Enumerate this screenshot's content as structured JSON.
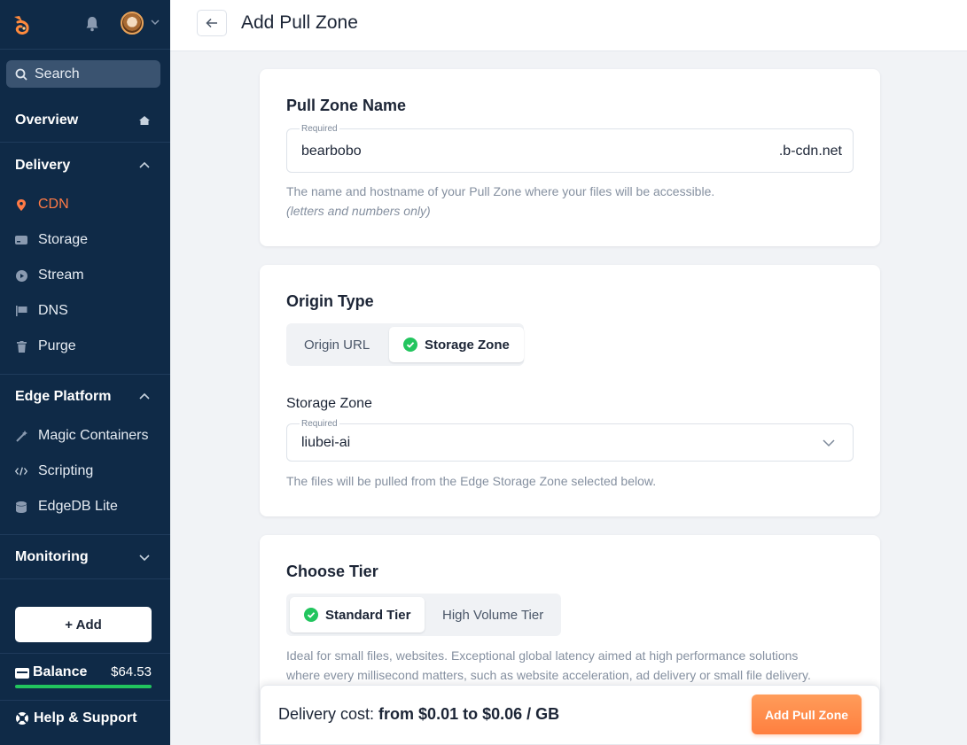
{
  "header": {
    "title": "Add Pull Zone"
  },
  "sidebar": {
    "search_label": "Search",
    "overview": "Overview",
    "delivery": {
      "title": "Delivery",
      "items": [
        {
          "label": "CDN",
          "icon": "pin-icon",
          "active": true
        },
        {
          "label": "Storage",
          "icon": "storage-icon"
        },
        {
          "label": "Stream",
          "icon": "play-icon"
        },
        {
          "label": "DNS",
          "icon": "flag-icon"
        },
        {
          "label": "Purge",
          "icon": "trash-icon"
        }
      ]
    },
    "edge": {
      "title": "Edge Platform",
      "items": [
        {
          "label": "Magic Containers",
          "icon": "wand-icon"
        },
        {
          "label": "Scripting",
          "icon": "code-icon"
        },
        {
          "label": "EdgeDB Lite",
          "icon": "database-icon"
        }
      ]
    },
    "monitoring": "Monitoring",
    "add_label": "+ Add",
    "balance_label": "Balance",
    "balance_value": "$64.53",
    "help_label": "Help & Support"
  },
  "pull_zone": {
    "title": "Pull Zone Name",
    "required": "Required",
    "value": "bearbobo",
    "suffix": ".b-cdn.net",
    "help": "The name and hostname of your Pull Zone where your files will be accessible.",
    "help_note": "(letters and numbers only)"
  },
  "origin": {
    "title": "Origin Type",
    "options": [
      "Origin URL",
      "Storage Zone"
    ],
    "selected": "Storage Zone",
    "storage_label": "Storage Zone",
    "required": "Required",
    "storage_value": "liubei-ai",
    "help": "The files will be pulled from the Edge Storage Zone selected below."
  },
  "tier": {
    "title": "Choose Tier",
    "options": [
      "Standard Tier",
      "High Volume Tier"
    ],
    "selected": "Standard Tier",
    "help_line1": "Ideal for small files, websites. Exceptional global latency aimed at high performance solutions",
    "help_line2": "where every millisecond matters, such as website acceleration, ad delivery or small file delivery."
  },
  "footer": {
    "cost_prefix": "Delivery cost:",
    "cost_value": "from $0.01 to $0.06 / GB",
    "submit_label": "Add Pull Zone"
  },
  "colors": {
    "accent": "#ff7a45",
    "sidebar": "#0f2a47",
    "success": "#22c55e"
  }
}
